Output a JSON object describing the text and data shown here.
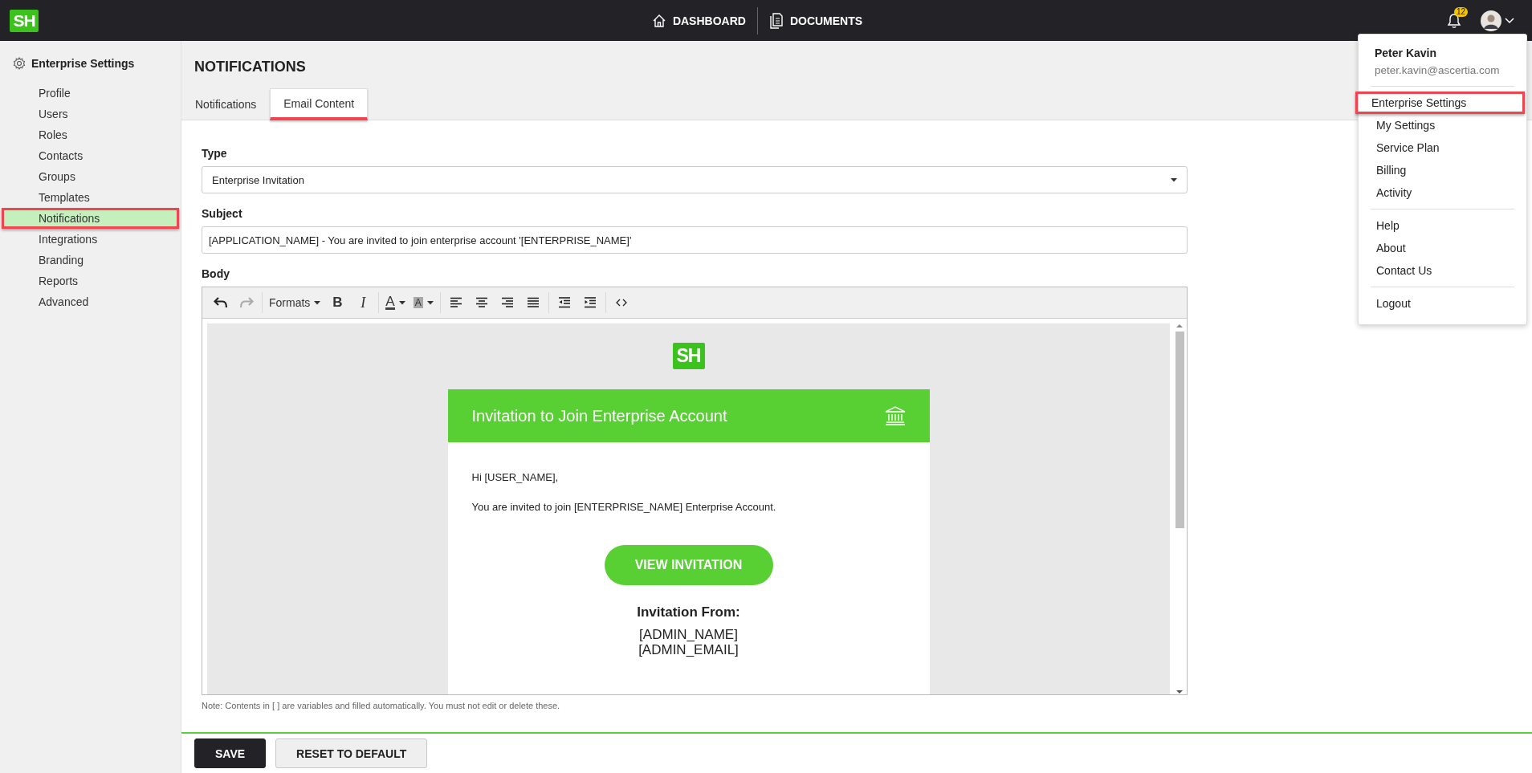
{
  "top_bar": {
    "logo": "SH",
    "nav": [
      {
        "label": "DASHBOARD",
        "kind": "home"
      },
      {
        "label": "DOCUMENTS",
        "kind": "document"
      }
    ],
    "notification_count": "12"
  },
  "sidebar": {
    "title": "Enterprise Settings",
    "items": [
      {
        "label": "Profile",
        "selected": false
      },
      {
        "label": "Users",
        "selected": false
      },
      {
        "label": "Roles",
        "selected": false
      },
      {
        "label": "Contacts",
        "selected": false
      },
      {
        "label": "Groups",
        "selected": false
      },
      {
        "label": "Templates",
        "selected": false
      },
      {
        "label": "Notifications",
        "selected": true
      },
      {
        "label": "Integrations",
        "selected": false
      },
      {
        "label": "Branding",
        "selected": false
      },
      {
        "label": "Reports",
        "selected": false
      },
      {
        "label": "Advanced",
        "selected": false
      }
    ]
  },
  "page": {
    "title": "NOTIFICATIONS",
    "tabs": [
      {
        "label": "Notifications",
        "selected": false
      },
      {
        "label": "Email Content",
        "selected": true
      }
    ]
  },
  "form": {
    "type": {
      "label": "Type",
      "value": "Enterprise Invitation"
    },
    "subject": {
      "label": "Subject",
      "value": "[APPLICATION_NAME] - You are invited to join enterprise account '[ENTERPRISE_NAME]'"
    },
    "body": {
      "label": "Body",
      "toolbar": [
        {
          "items": [
            {
              "kind": "undo",
              "disabled": false
            },
            {
              "kind": "redo",
              "disabled": true
            }
          ]
        },
        {
          "items": [
            {
              "kind": "formats",
              "label": "Formats"
            },
            {
              "kind": "bold",
              "label": "B"
            },
            {
              "kind": "italic",
              "label": "I"
            }
          ]
        },
        {
          "items": [
            {
              "kind": "forecolor",
              "label": "A"
            },
            {
              "kind": "backcolor",
              "label": "A"
            }
          ]
        },
        {
          "items": [
            {
              "kind": "alignleft"
            },
            {
              "kind": "aligncenter"
            },
            {
              "kind": "alignright"
            },
            {
              "kind": "justify"
            }
          ]
        },
        {
          "items": [
            {
              "kind": "outdent"
            },
            {
              "kind": "indent"
            }
          ]
        },
        {
          "items": [
            {
              "kind": "code"
            }
          ]
        }
      ],
      "email": {
        "logo": "SH",
        "title": "Invitation to Join Enterprise Account",
        "greeting": "Hi [USER_NAME],",
        "message": "You are invited to join [ENTERPRISE_NAME] Enterprise Account.",
        "button": "VIEW INVITATION",
        "from_heading": "Invitation From:",
        "from_lines": [
          "[ADMIN_NAME]",
          "[ADMIN_EMAIL]"
        ]
      }
    },
    "note": "Note: Contents in [ ] are variables and filled automatically. You must not edit or delete these."
  },
  "actions": [
    {
      "label": "SAVE",
      "kind": "primary"
    },
    {
      "label": "RESET TO DEFAULT",
      "kind": "secondary"
    }
  ],
  "user_menu": {
    "name": "Peter Kavin",
    "email": "peter.kavin@ascertia.com",
    "groups": [
      {
        "items": [
          {
            "label": "Enterprise Settings",
            "selected": true
          },
          {
            "label": "My Settings",
            "selected": false
          },
          {
            "label": "Service Plan",
            "selected": false
          },
          {
            "label": "Billing",
            "selected": false
          },
          {
            "label": "Activity",
            "selected": false
          }
        ]
      },
      {
        "items": [
          {
            "label": "Help",
            "selected": false
          },
          {
            "label": "About",
            "selected": false
          },
          {
            "label": "Contact Us",
            "selected": false
          }
        ]
      },
      {
        "items": [
          {
            "label": "Logout",
            "selected": false
          }
        ]
      }
    ]
  }
}
